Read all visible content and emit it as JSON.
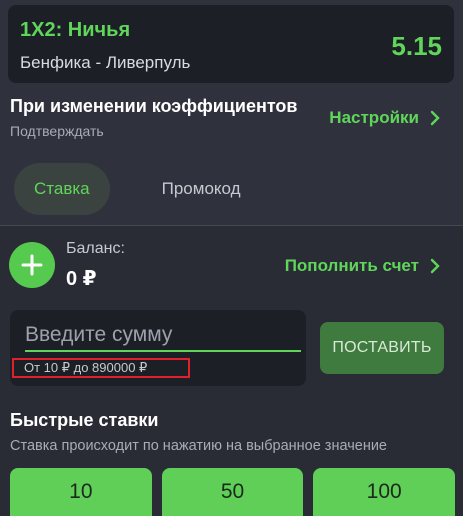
{
  "bet": {
    "title": "1X2: Ничья",
    "match": "Бенфика - Ливерпуль",
    "odds": "5.15"
  },
  "odds_change": {
    "title": "При изменении коэффициентов",
    "mode": "Подтверждать",
    "settings_label": "Настройки"
  },
  "tabs": [
    {
      "label": "Ставка",
      "active": true
    },
    {
      "label": "Промокод",
      "active": false
    }
  ],
  "balance": {
    "label": "Баланс:",
    "value": "0 ₽",
    "topup_label": "Пополнить счет"
  },
  "amount": {
    "placeholder": "Введите сумму",
    "range": "От 10 ₽ до 890000 ₽"
  },
  "place_bet_label": "ПОСТАВИТЬ",
  "quick_bets": {
    "title": "Быстрые ставки",
    "subtitle": "Ставка происходит по нажатию на выбранное значение",
    "values": [
      "10",
      "50",
      "100"
    ]
  },
  "colors": {
    "accent": "#5fd65a",
    "highlight": "#e0202a"
  }
}
